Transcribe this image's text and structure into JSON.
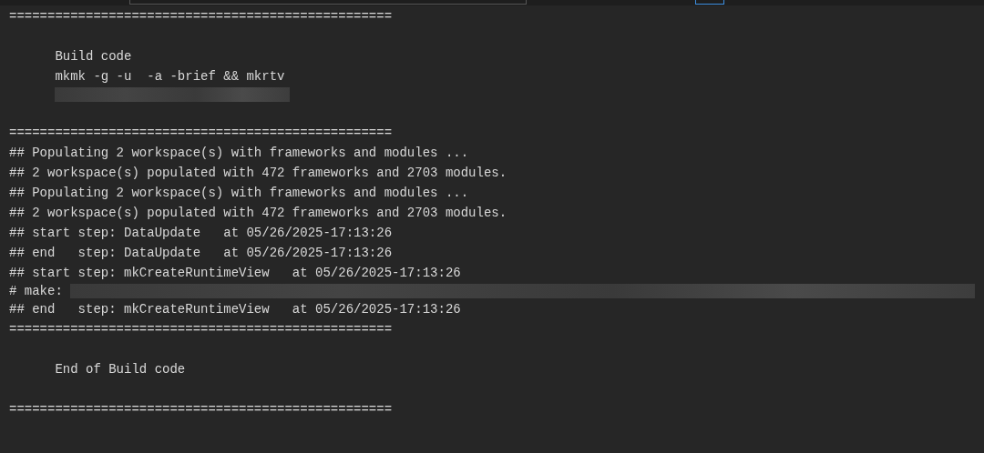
{
  "console": {
    "lines": [
      {
        "kind": "text",
        "text": "=================================================="
      },
      {
        "kind": "blank"
      },
      {
        "kind": "text",
        "text": "      Build code"
      },
      {
        "kind": "text",
        "text": "      mkmk -g -u  -a -brief && mkrtv"
      },
      {
        "kind": "redacted"
      },
      {
        "kind": "blank"
      },
      {
        "kind": "text",
        "text": "=================================================="
      },
      {
        "kind": "text",
        "text": "## Populating 2 workspace(s) with frameworks and modules ..."
      },
      {
        "kind": "text",
        "text": "## 2 workspace(s) populated with 472 frameworks and 2703 modules."
      },
      {
        "kind": "text",
        "text": "## Populating 2 workspace(s) with frameworks and modules ..."
      },
      {
        "kind": "text",
        "text": "## 2 workspace(s) populated with 472 frameworks and 2703 modules."
      },
      {
        "kind": "text",
        "text": "## start step: DataUpdate   at 05/26/2025-17:13:26"
      },
      {
        "kind": "text",
        "text": "## end   step: DataUpdate   at 05/26/2025-17:13:26"
      },
      {
        "kind": "text",
        "text": "## start step: mkCreateRuntimeView   at 05/26/2025-17:13:26"
      },
      {
        "kind": "redacted",
        "text": "# make:"
      },
      {
        "kind": "text",
        "text": "## end   step: mkCreateRuntimeView   at 05/26/2025-17:13:26"
      },
      {
        "kind": "text",
        "text": "=================================================="
      },
      {
        "kind": "blank"
      },
      {
        "kind": "text",
        "text": "      End of Build code"
      },
      {
        "kind": "blank"
      },
      {
        "kind": "text",
        "text": "=================================================="
      }
    ]
  }
}
